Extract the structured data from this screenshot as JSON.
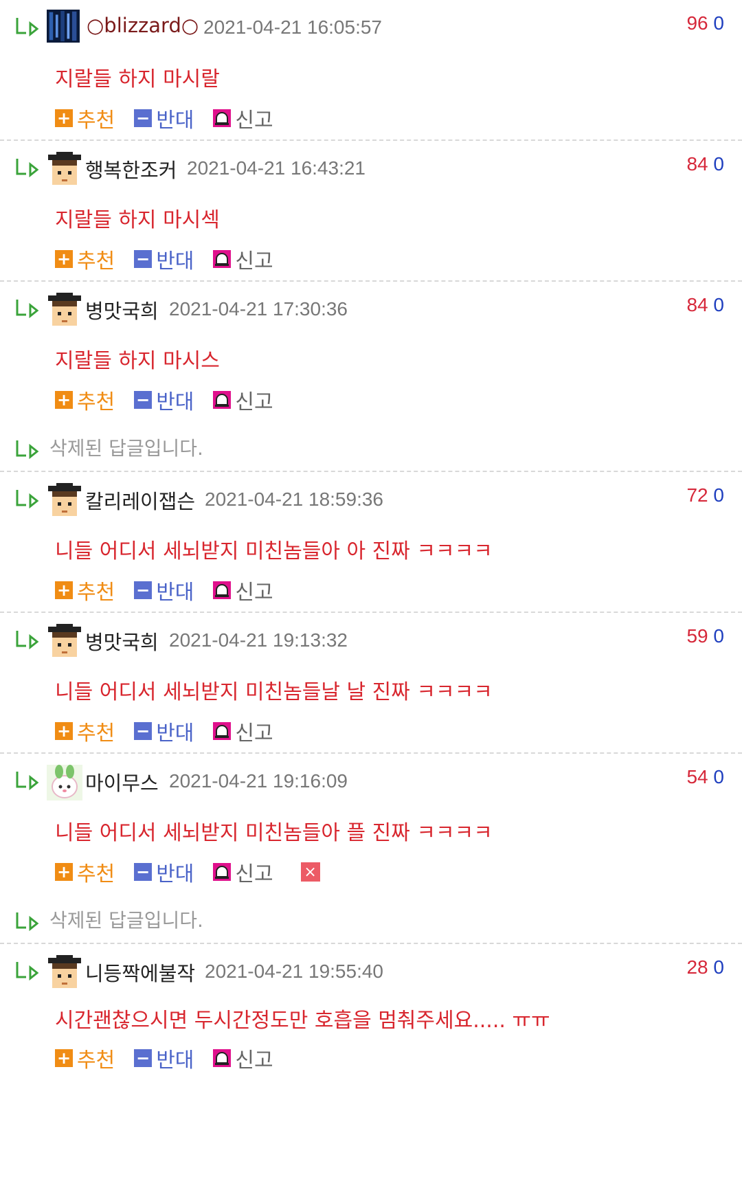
{
  "labels": {
    "recommend": "추천",
    "oppose": "반대",
    "report": "신고",
    "plus_glyph": "+",
    "minus_glyph": "−",
    "x_glyph": "×"
  },
  "comments": [
    {
      "nick": "○blizzard○",
      "date": "2021-04-21 16:05:57",
      "up": "96",
      "down": "0",
      "text": "지랄들 하지 마시랄",
      "avatar": "pixel-static-avatar"
    },
    {
      "nick": "행복한조커",
      "date": "2021-04-21 16:43:21",
      "up": "84",
      "down": "0",
      "text": "지랄들 하지 마시섹",
      "avatar": "graduate-avatar"
    },
    {
      "nick": "병맛국희",
      "date": "2021-04-21 17:30:36",
      "up": "84",
      "down": "0",
      "text": "지랄들 하지 마시스",
      "avatar": "graduate-avatar"
    },
    {
      "deleted": "삭제된 답글입니다."
    },
    {
      "nick": "칼리레이잽슨",
      "date": "2021-04-21 18:59:36",
      "up": "72",
      "down": "0",
      "text": "니들 어디서 세뇌받지 미친놈들아 아 진짜 ㅋㅋㅋㅋ",
      "avatar": "graduate-avatar"
    },
    {
      "nick": "병맛국희",
      "date": "2021-04-21 19:13:32",
      "up": "59",
      "down": "0",
      "text": "니들 어디서 세뇌받지 미친놈들날 날 진짜 ㅋㅋㅋㅋ",
      "avatar": "graduate-avatar"
    },
    {
      "nick": "마이무스",
      "date": "2021-04-21 19:16:09",
      "up": "54",
      "down": "0",
      "text": "니들 어디서 세뇌받지 미친놈들아 플 진짜 ㅋㅋㅋㅋ",
      "avatar": "bunny-avatar",
      "deletable": true
    },
    {
      "deleted": "삭제된 답글입니다."
    },
    {
      "nick": "니등짝에불작",
      "date": "2021-04-21 19:55:40",
      "up": "28",
      "down": "0",
      "text": "시간괜찮으시면 두시간정도만 호흡을 멈춰주세요..... ㅠㅠ",
      "avatar": "graduate-avatar"
    }
  ]
}
